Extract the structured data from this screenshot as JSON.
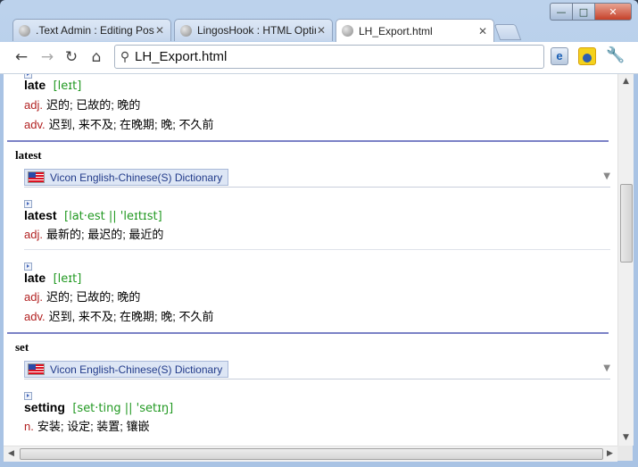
{
  "window": {
    "controls": {
      "minimize": "—",
      "maximize": "□",
      "close": "✕"
    }
  },
  "tabs": [
    {
      "title": ".Text Admin : Editing Post",
      "active": false
    },
    {
      "title": "LingosHook : HTML Optimi",
      "active": false
    },
    {
      "title": "LH_Export.html",
      "active": true
    }
  ],
  "toolbar": {
    "address": "LH_Export.html",
    "icons": [
      "back-icon",
      "forward-icon",
      "reload-icon",
      "home-icon",
      "search-icon",
      "ie-tab-icon",
      "lingoshook-icon",
      "wrench-icon"
    ]
  },
  "dictionary_name": "Vicon English-Chinese(S) Dictionary",
  "block_top": {
    "headword": "late",
    "phonetic": "[leɪt]",
    "senses": [
      {
        "pos": "adj.",
        "text": "迟的; 已故的; 晚的"
      },
      {
        "pos": "adv.",
        "text": "迟到, 来不及; 在晚期; 晚; 不久前"
      }
    ]
  },
  "query_latest": {
    "word": "latest",
    "entries": [
      {
        "headword": "latest",
        "phonetic": "[lat·est || 'leɪtɪst]",
        "senses": [
          {
            "pos": "adj.",
            "text": "最新的; 最迟的; 最近的"
          }
        ]
      },
      {
        "headword": "late",
        "phonetic": "[leɪt]",
        "senses": [
          {
            "pos": "adj.",
            "text": "迟的; 已故的; 晚的"
          },
          {
            "pos": "adv.",
            "text": "迟到, 来不及; 在晚期; 晚; 不久前"
          }
        ]
      }
    ]
  },
  "query_set": {
    "word": "set",
    "entries": [
      {
        "headword": "setting",
        "phonetic": "[set·ting || 'setɪŋ]",
        "senses": [
          {
            "pos": "n.",
            "text": "安装; 设定; 装置; 镶嵌"
          }
        ]
      }
    ]
  },
  "colors": {
    "pos": "#b22222",
    "phonetic": "#229922",
    "separator": "#7b82c6",
    "dict_label_bg": "#dde6f5"
  }
}
